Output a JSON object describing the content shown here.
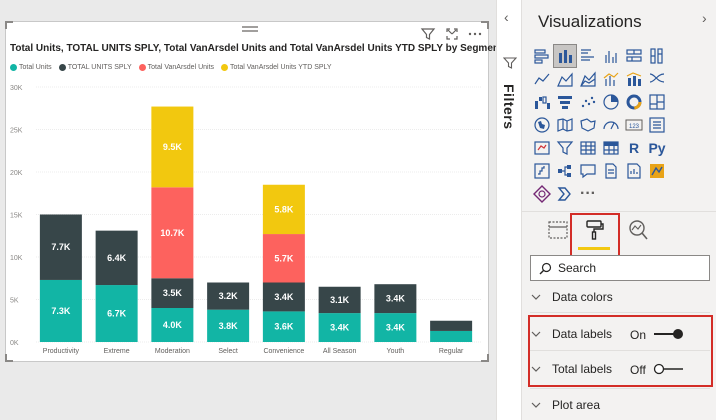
{
  "chart": {
    "title": "Total Units, TOTAL UNITS SPLY, Total VanArsdel Units and Total VanArsdel Units YTD SPLY by Segment",
    "legend": [
      {
        "label": "Total Units",
        "color": "#12b5a5"
      },
      {
        "label": "TOTAL UNITS SPLY",
        "color": "#374649"
      },
      {
        "label": "Total VanArsdel Units",
        "color": "#fd625e"
      },
      {
        "label": "Total VanArsdel Units YTD SPLY",
        "color": "#f2c80f"
      }
    ]
  },
  "chart_data": {
    "type": "bar",
    "stacked": true,
    "categories": [
      "Productivity",
      "Extreme",
      "Moderation",
      "Select",
      "Convenience",
      "All Season",
      "Youth",
      "Regular"
    ],
    "series": [
      {
        "name": "Total Units",
        "color": "#12b5a5",
        "values": [
          7300,
          6700,
          4000,
          3800,
          3600,
          3400,
          3400,
          1300
        ],
        "labels": [
          "7.3K",
          "6.7K",
          "4.0K",
          "3.8K",
          "3.6K",
          "3.4K",
          "3.4K",
          ""
        ]
      },
      {
        "name": "TOTAL UNITS SPLY",
        "color": "#374649",
        "values": [
          7700,
          6400,
          3500,
          3200,
          3400,
          3100,
          3400,
          1200
        ],
        "labels": [
          "7.7K",
          "6.4K",
          "3.5K",
          "3.2K",
          "3.4K",
          "3.1K",
          "3.4K",
          ""
        ]
      },
      {
        "name": "Total VanArsdel Units",
        "color": "#fd625e",
        "values": [
          0,
          0,
          10700,
          0,
          5700,
          0,
          0,
          0
        ],
        "labels": [
          "",
          "",
          "10.7K",
          "",
          "5.7K",
          "",
          "",
          ""
        ]
      },
      {
        "name": "Total VanArsdel Units YTD SPLY",
        "color": "#f2c80f",
        "values": [
          0,
          0,
          9500,
          0,
          5800,
          0,
          0,
          0
        ],
        "labels": [
          "",
          "",
          "9.5K",
          "",
          "5.8K",
          "",
          "",
          ""
        ]
      }
    ],
    "yticks": [
      "0K",
      "5K",
      "10K",
      "15K",
      "20K",
      "25K",
      "30K"
    ],
    "ylim": [
      0,
      30000
    ],
    "grid": true,
    "legend_position": "top-left"
  },
  "filters": {
    "label": "Filters"
  },
  "visualizations": {
    "title": "Visualizations",
    "icons": [
      "stacked-bar-chart-icon",
      "stacked-column-chart-icon",
      "clustered-bar-chart-icon",
      "clustered-column-chart-icon",
      "100-percent-bar-chart-icon",
      "100-percent-column-chart-icon",
      "line-chart-icon",
      "area-chart-icon",
      "stacked-area-chart-icon",
      "line-clustered-column-icon",
      "line-stacked-column-icon",
      "ribbon-chart-icon",
      "waterfall-chart-icon",
      "funnel-chart-icon",
      "scatter-chart-icon",
      "pie-chart-icon",
      "donut-chart-icon",
      "treemap-icon",
      "map-icon",
      "filled-map-icon",
      "shape-map-icon",
      "gauge-icon",
      "card-icon",
      "multi-row-card-icon",
      "kpi-icon",
      "slicer-icon",
      "table-icon",
      "matrix-icon",
      "r-script-visual-icon",
      "python-visual-icon",
      "key-influencers-icon",
      "decomposition-tree-icon",
      "qa-visual-icon",
      "paginated-report-icon",
      "smart-narrative-icon",
      "arcgis-map-icon",
      "power-apps-icon",
      "power-automate-icon",
      "more-visuals-icon"
    ],
    "r_label": "R",
    "py_label": "Py",
    "card_label": "123",
    "more_label": "···",
    "search_placeholder": "Search",
    "sections": {
      "data_colors": "Data colors",
      "data_labels": "Data labels",
      "data_labels_value": "On",
      "total_labels": "Total labels",
      "total_labels_value": "Off",
      "plot_area": "Plot area"
    },
    "accent_color": "#f2c811",
    "highlight_color": "#d32d27"
  }
}
